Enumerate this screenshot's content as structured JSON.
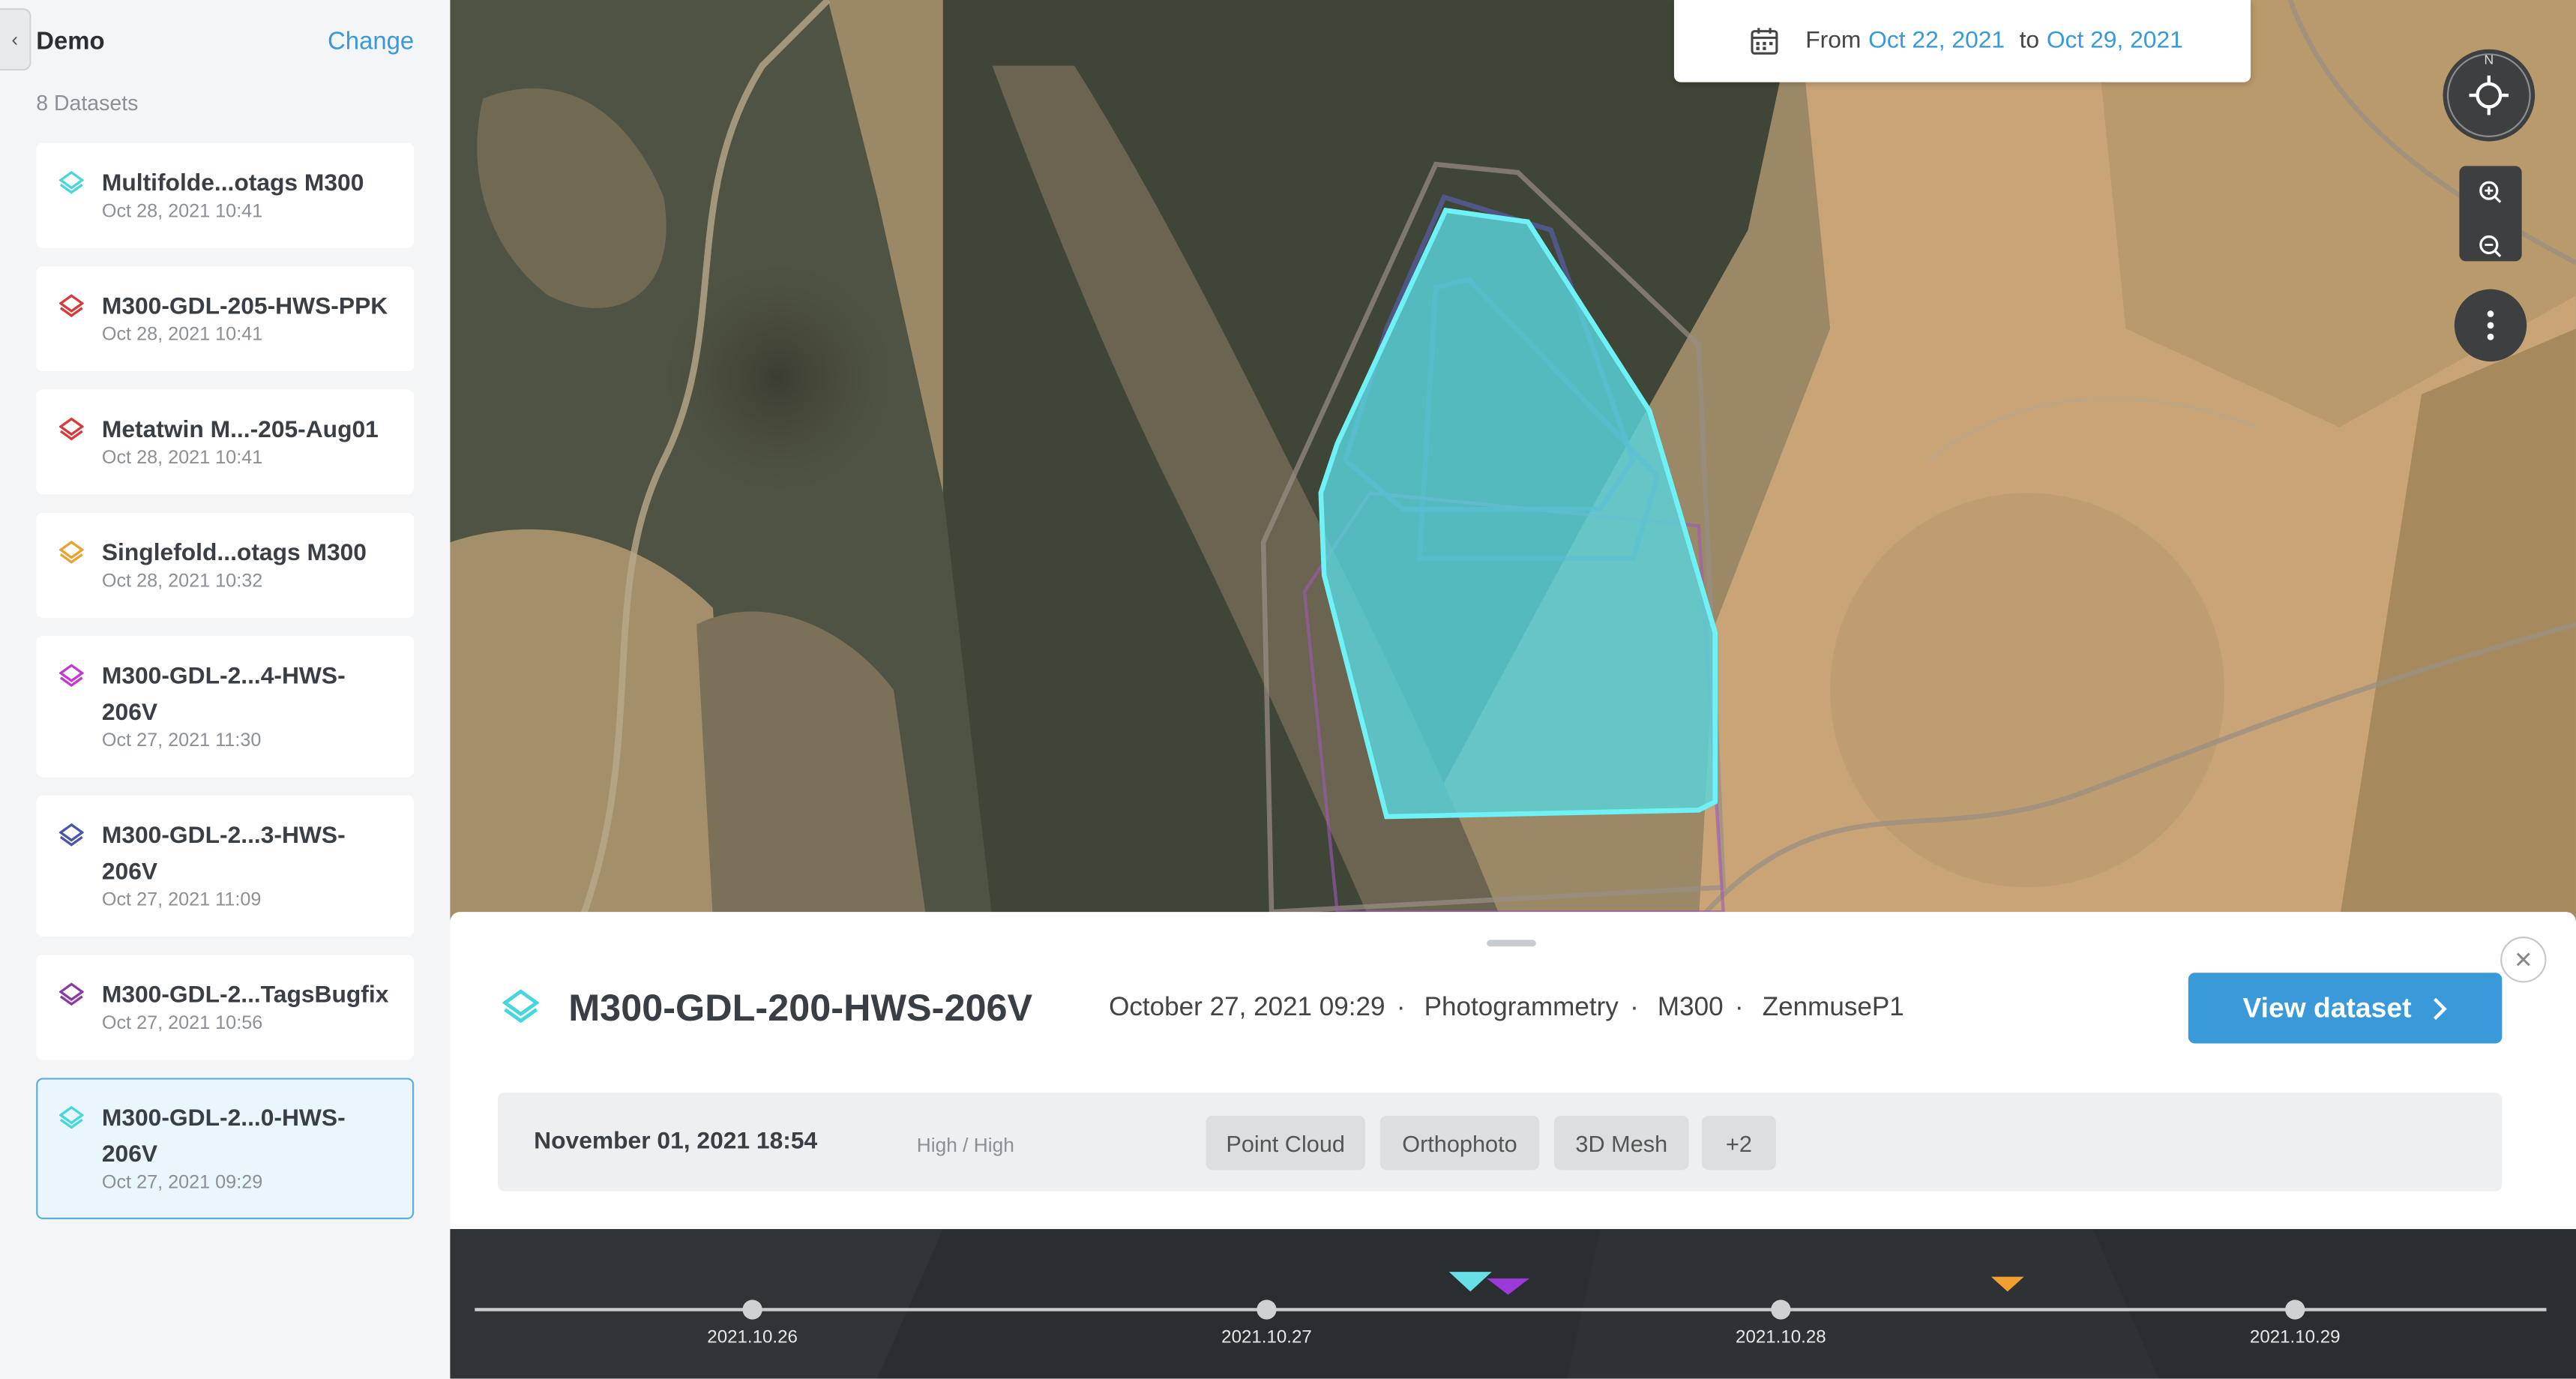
{
  "sidebar": {
    "project_name": "Demo",
    "change_label": "Change",
    "dataset_count": "8 Datasets",
    "datasets": [
      {
        "name": "Multifolde...otags M300",
        "date": "Oct 28, 2021 10:41",
        "color": "#46d6dd"
      },
      {
        "name": "M300-GDL-205-HWS-PPK",
        "date": "Oct 28, 2021 10:41",
        "color": "#d83a3a"
      },
      {
        "name": "Metatwin M...-205-Aug01",
        "date": "Oct 28, 2021 10:41",
        "color": "#d83a3a"
      },
      {
        "name": "Singlefold...otags M300",
        "date": "Oct 28, 2021 10:32",
        "color": "#e8a32c"
      },
      {
        "name": "M300-GDL-2...4-HWS-206V",
        "date": "Oct 27, 2021 11:30",
        "color": "#c43ad0"
      },
      {
        "name": "M300-GDL-2...3-HWS-206V",
        "date": "Oct 27, 2021 11:09",
        "color": "#4a55a8"
      },
      {
        "name": "M300-GDL-2...TagsBugfix",
        "date": "Oct 27, 2021 10:56",
        "color": "#8a3aa8"
      },
      {
        "name": "M300-GDL-2...0-HWS-206V",
        "date": "Oct 27, 2021 09:29",
        "color": "#46d6dd",
        "selected": true
      }
    ]
  },
  "datebar": {
    "from_label": "From",
    "from_date": "Oct 22, 2021",
    "to_label": "to",
    "to_date": "Oct 29, 2021"
  },
  "map_controls": {
    "compass_letter": "N"
  },
  "panel": {
    "title": "M300-GDL-200-HWS-206V",
    "date": "October 27, 2021 09:29",
    "type": "Photogrammetry",
    "drone": "M300",
    "sensor": "ZenmuseP1",
    "view_button": "View dataset",
    "row": {
      "date": "November 01, 2021 18:54",
      "quality": "High / High",
      "tags": [
        "Point Cloud",
        "Orthophoto",
        "3D Mesh",
        "+2"
      ]
    }
  },
  "timeline": {
    "labels": [
      "2021.10.26",
      "2021.10.27",
      "2021.10.28",
      "2021.10.29"
    ],
    "marker_colors": [
      "#66e0e6",
      "#9a3ad8",
      "#f0a030"
    ]
  }
}
